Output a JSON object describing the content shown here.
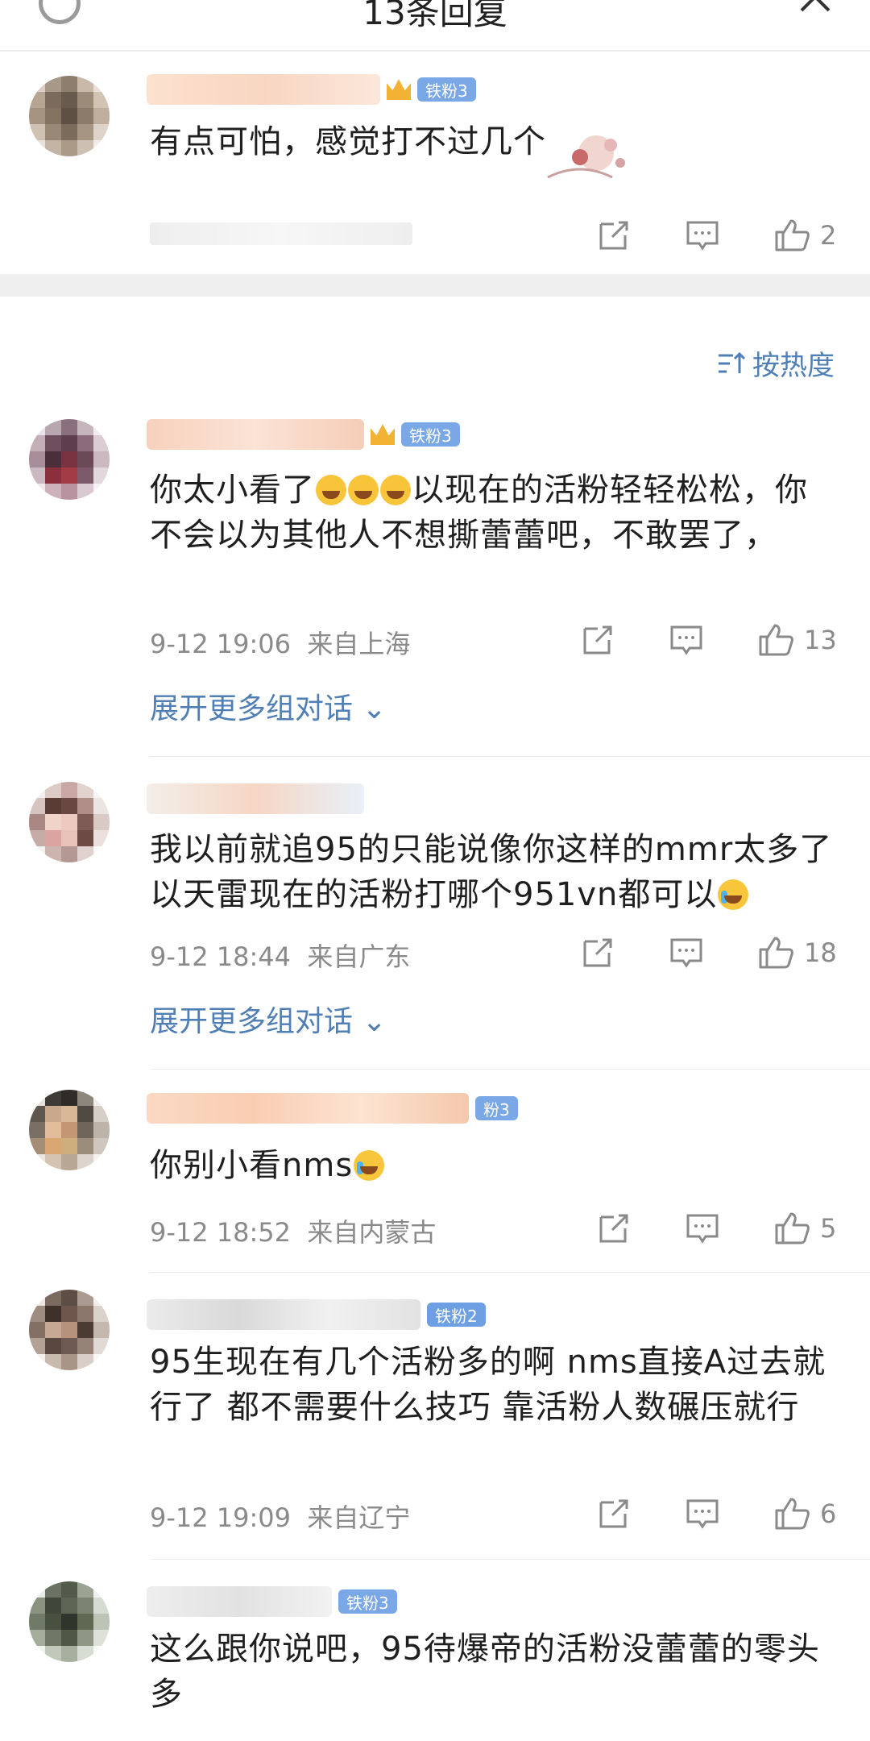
{
  "header": {
    "title": "13条回复"
  },
  "top_comment": {
    "badge": "铁粉3",
    "text": "有点可怕，感觉打不过几个",
    "likes": "2"
  },
  "sort_label": "按热度",
  "comments": [
    {
      "badge": "铁粉3",
      "text_parts": [
        "你太小看了",
        "以现在的活粉轻轻松松，你不会以为其他人不想撕蕾蕾吧，不敢罢了，"
      ],
      "time": "9-12 19:06",
      "location": "来自上海",
      "likes": "13",
      "expand": "展开更多组对话"
    },
    {
      "badge": "",
      "text_parts": [
        "我以前就追95的只能说像你这样的mmr太多了以天雷现在的活粉打哪个951vn都可以"
      ],
      "time": "9-12 18:44",
      "location": "来自广东",
      "likes": "18",
      "expand": "展开更多组对话"
    },
    {
      "badge": "粉3",
      "text_parts": [
        "你别小看nms"
      ],
      "time": "9-12 18:52",
      "location": "来自内蒙古",
      "likes": "5"
    },
    {
      "badge": "铁粉2",
      "text_parts": [
        "95生现在有几个活粉多的啊  nms直接A过去就行了 都不需要什么技巧  靠活粉人数碾压就行"
      ],
      "time": "9-12 19:09",
      "location": "来自辽宁",
      "likes": "6"
    },
    {
      "badge": "铁粉3",
      "text_parts": [
        "这么跟你说吧，95待爆帝的活粉没蕾蕾的零头多"
      ]
    }
  ],
  "icons": [
    "refresh-icon",
    "close-icon",
    "share-icon",
    "comment-icon",
    "like-icon",
    "sort-icon",
    "chevron-down-icon",
    "laugh-emoji-icon",
    "cry-emoji-icon"
  ],
  "colors": {
    "link_blue": "#4f7fb5",
    "badge_blue": "#7aa7e5",
    "meta_gray": "#8a8a8a"
  }
}
